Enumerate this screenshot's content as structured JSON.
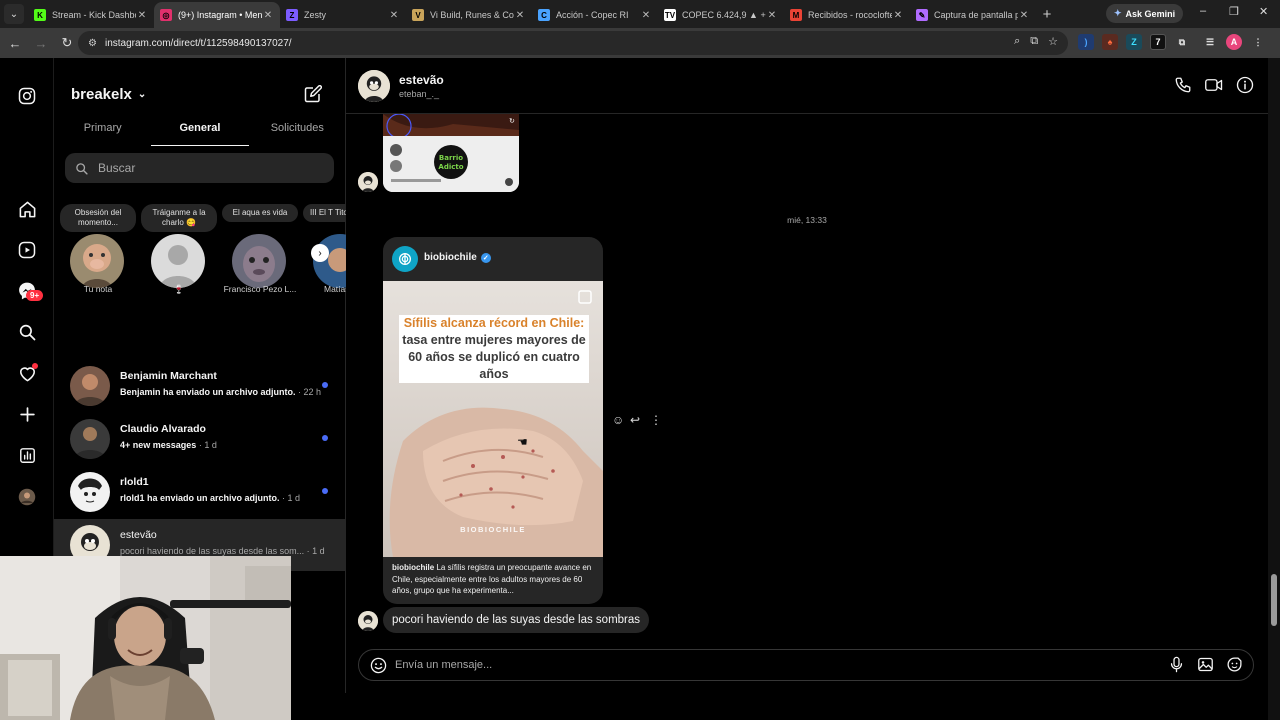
{
  "browser": {
    "tabs": [
      {
        "title": "Stream - Kick Dashboa",
        "favicon_color": "#53fc18",
        "glyph": "K"
      },
      {
        "title": "(9+) Instagram • Mens",
        "favicon_color": "#e1306c",
        "glyph": "◎",
        "active": true
      },
      {
        "title": "Zesty",
        "favicon_color": "#7c5cff",
        "glyph": "Z"
      },
      {
        "title": "Vi Build, Runes & Coun",
        "favicon_color": "#c9a45a",
        "glyph": "V"
      },
      {
        "title": "Acción - Copec RI",
        "favicon_color": "#4aa3ff",
        "glyph": "C"
      },
      {
        "title": "COPEC 6.424,9 ▲ +3.2",
        "favicon_color": "#ffffff",
        "glyph": "TV"
      },
      {
        "title": "Recibidos - rococlofte",
        "favicon_color": "#ea4335",
        "glyph": "M"
      },
      {
        "title": "Captura de pantalla p",
        "favicon_color": "#b06bff",
        "glyph": "✎"
      }
    ],
    "new_tab": "+",
    "gemini_label": "Ask Gemini",
    "url": "instagram.com/direct/t/112598490137027/"
  },
  "inbox": {
    "account": "breakelx",
    "tabs": [
      {
        "label": "Primary",
        "selected": false
      },
      {
        "label": "General",
        "selected": true
      },
      {
        "label": "Solicitudes",
        "selected": false
      }
    ],
    "search_placeholder": "Buscar",
    "notifications_badge": "9+",
    "notes": [
      {
        "bubble": "Obsesión del momento...",
        "name": "Tu nota"
      },
      {
        "bubble": "Tráiganme a la charlo 😋",
        "name": "🍷"
      },
      {
        "bubble": "El aqua es vida",
        "name": "Francisco Pezo L..."
      },
      {
        "bubble": "III El T Tito \"El Ba",
        "name": "Matías C"
      }
    ],
    "conversations": [
      {
        "name": "Benjamin Marchant",
        "preview": "Benjamin ha enviado un archivo adjunto.",
        "time": "· 22 h",
        "unread": true
      },
      {
        "name": "Claudio Alvarado",
        "preview": "4+ new messages",
        "time": "· 1 d",
        "unread": true
      },
      {
        "name": "rlold1",
        "preview": "rlold1 ha enviado un archivo adjunto.",
        "time": "· 1 d",
        "unread": true
      },
      {
        "name": "estevão",
        "preview": "pocori haviendo de las suyas desde las som...",
        "time": "· 1 d",
        "unread": false,
        "selected": true
      }
    ]
  },
  "chat": {
    "name": "estevão",
    "username": "eteban_._",
    "timestamp": "mié, 13:33",
    "shared_post": {
      "account": "biobiochile",
      "headline_accent": "Sífilis alcanza récord en Chile:",
      "headline_rest": "tasa entre mujeres mayores de 60 años se duplicó en cuatro años",
      "watermark": "BIOBIOCHILE",
      "caption_user": "biobiochile",
      "caption_text": "La sífilis registra un preocupante avance en Chile, especialmente entre los adultos mayores de 60 años, grupo que ha experimenta..."
    },
    "message_text": "pocori haviendo de las suyas desde las sombras",
    "composer_placeholder": "Envía un mensaje..."
  }
}
